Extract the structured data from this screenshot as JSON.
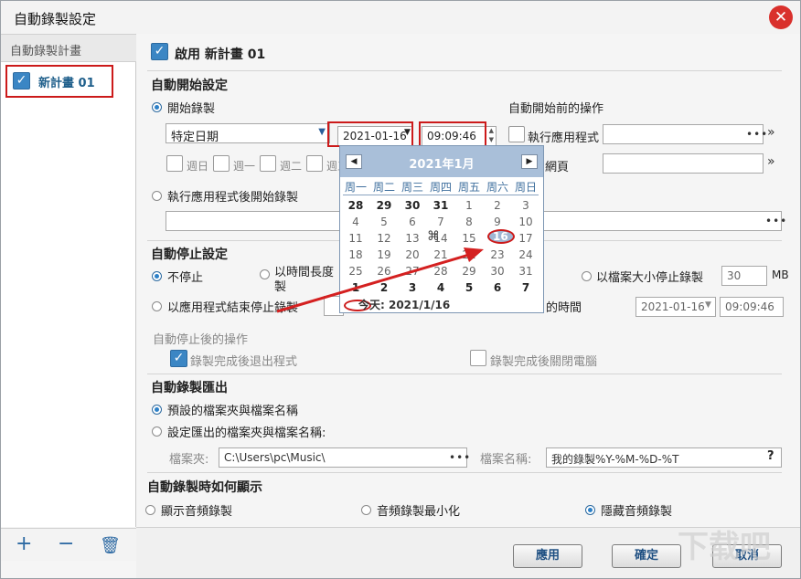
{
  "window": {
    "title": "自動錄製設定",
    "close": "✕"
  },
  "sidebar": {
    "header": "自動錄製計畫",
    "item": "新計畫 01",
    "add": "+",
    "remove": "−",
    "delete": "🗑"
  },
  "enable": {
    "label": "啟用 新計畫 01"
  },
  "start": {
    "title": "自動開始設定",
    "start_record": "開始錄製",
    "mode": "特定日期",
    "date": "2021-01-16",
    "time": "09:09:46",
    "weekdays": [
      "週日",
      "週一",
      "週二",
      "週三"
    ],
    "after_app": "執行應用程式後開始錄製",
    "before_title": "自動開始前的操作",
    "run_app": "執行應用程式",
    "open_web_tail": "網頁",
    "dots": "•••",
    "chevron": "»"
  },
  "calendar": {
    "month": "2021年1月",
    "prev": "◀",
    "next": "▶",
    "weekdays": [
      "周一",
      "周二",
      "周三",
      "周四",
      "周五",
      "周六",
      "周日"
    ],
    "weeks": [
      [
        "28",
        "29",
        "30",
        "31",
        "1",
        "2",
        "3"
      ],
      [
        "4",
        "5",
        "6",
        "7",
        "8",
        "9",
        "10"
      ],
      [
        "11",
        "12",
        "13",
        "14",
        "15",
        "16",
        "17"
      ],
      [
        "18",
        "19",
        "20",
        "21",
        "22",
        "23",
        "24"
      ],
      [
        "25",
        "26",
        "27",
        "28",
        "29",
        "30",
        "31"
      ],
      [
        "1",
        "2",
        "3",
        "4",
        "5",
        "6",
        "7"
      ]
    ],
    "selected": "16",
    "today": "今天: 2021/1/16"
  },
  "stop": {
    "title": "自動停止設定",
    "no_stop": "不停止",
    "by_duration_1": "以時間長度",
    "by_duration_2": "製",
    "by_size": "以檔案大小停止錄製",
    "size_value": "30",
    "size_unit": "MB",
    "by_app_end": "以應用程式結束停止錄製",
    "time_tail": "的時間",
    "stop_date": "2021-01-16",
    "stop_time": "09:09:46",
    "after_title": "自動停止後的操作",
    "exit_app": "錄製完成後退出程式",
    "shutdown": "錄製完成後關閉電腦"
  },
  "export": {
    "title": "自動錄製匯出",
    "default": "預設的檔案夾與檔案名稱",
    "custom": "設定匯出的檔案夾與檔案名稱:",
    "folder_label": "檔案夾:",
    "folder": "C:\\Users\\pc\\Music\\",
    "name_label": "檔案名稱:",
    "name": "我的錄製%Y-%M-%D-%T",
    "help": "?"
  },
  "display": {
    "title": "自動錄製時如何顯示",
    "show": "顯示音頻錄製",
    "minimize": "音頻錄製最小化",
    "hide": "隱藏音頻錄製"
  },
  "footer": {
    "apply": "應用",
    "ok": "確定",
    "cancel": "取消"
  },
  "watermark": "下载吧"
}
